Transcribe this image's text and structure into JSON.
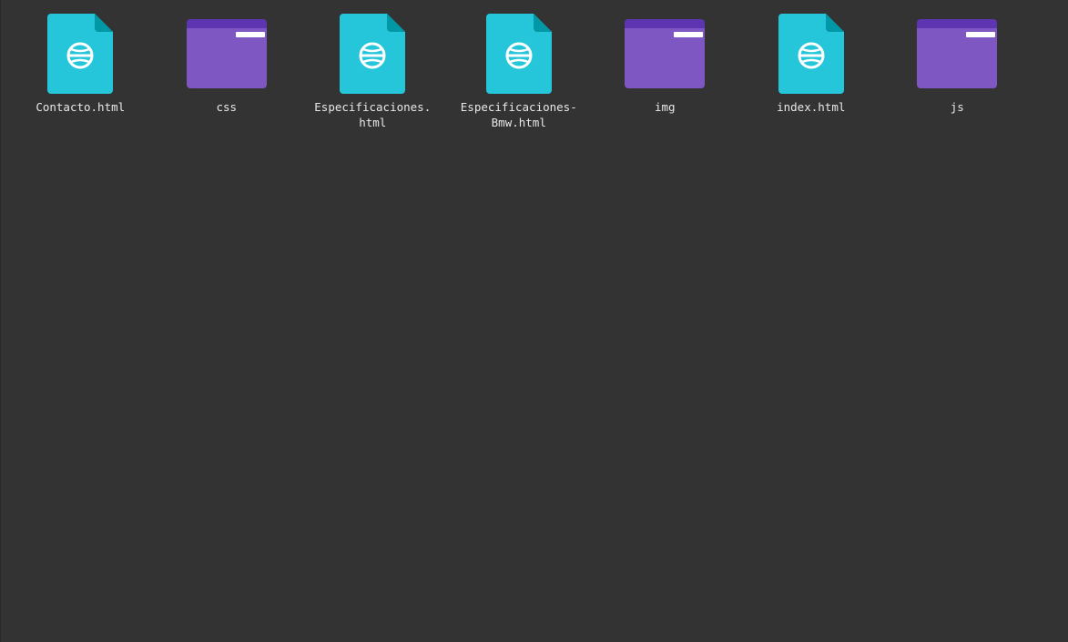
{
  "colors": {
    "background": "#333333",
    "file_icon": "#26c6da",
    "file_icon_fold": "#0097a7",
    "folder_front": "#7e57c2",
    "folder_back": "#5e35b1",
    "label_text": "#e8e8e8"
  },
  "files": [
    {
      "name": "Contacto.html",
      "display": "Contacto.html",
      "icon": "html-file-icon",
      "kind": "file"
    },
    {
      "name": "css",
      "display": "css",
      "icon": "folder-icon",
      "kind": "folder"
    },
    {
      "name": "Especificaciones.html",
      "display": "Especificaciones.\nhtml",
      "icon": "html-file-icon",
      "kind": "file"
    },
    {
      "name": "Especificaciones-Bmw.html",
      "display": "Especificaciones-\nBmw.html",
      "icon": "html-file-icon",
      "kind": "file"
    },
    {
      "name": "img",
      "display": "img",
      "icon": "folder-icon",
      "kind": "folder"
    },
    {
      "name": "index.html",
      "display": "index.html",
      "icon": "html-file-icon",
      "kind": "file"
    },
    {
      "name": "js",
      "display": "js",
      "icon": "folder-icon",
      "kind": "folder"
    }
  ]
}
